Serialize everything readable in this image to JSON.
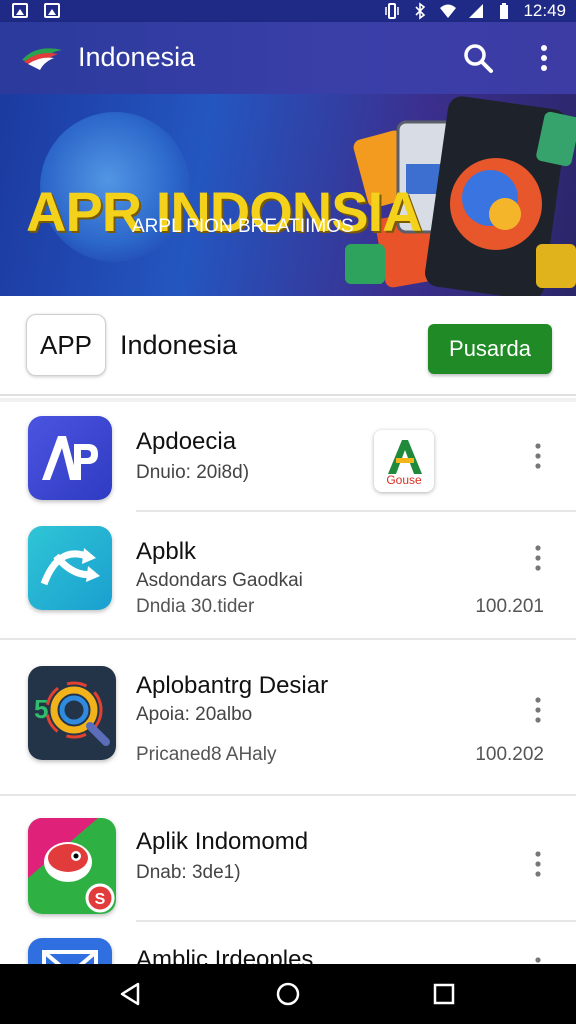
{
  "status_bar": {
    "time": "12:49"
  },
  "app_bar": {
    "title": "Indonesia"
  },
  "banner": {
    "title": "APR INDONSIA",
    "subtitle": "ARPL PION BREATIIMOS",
    "active_slide": 1,
    "slide_count": 2
  },
  "header_card": {
    "badge_label": "APP",
    "name": "Indonesia",
    "button_label": "Pusarda",
    "button_color": "#1f8a26"
  },
  "list": {
    "items": [
      {
        "title": "Apdoecia",
        "subtitle": "Dnuio: 20i8d)",
        "icon": "ap-logo-icon",
        "badge_label": "Gouse"
      },
      {
        "title": "Apblk",
        "subtitle": "Asdondars Gaodkai",
        "meta": "Dndia 30.tider",
        "right": "100.201",
        "icon": "shuffle-icon"
      },
      {
        "title": "Aplobantrg Desiar",
        "subtitle": "Apoia: 20albo",
        "meta": "Pricaned8 AHaly",
        "right": "100.202",
        "icon": "search-lens-icon"
      },
      {
        "title": "Aplik Indomomd",
        "subtitle": "Dnab: 3de1)",
        "icon": "bird-icon"
      },
      {
        "title": "Amblic Irdeoples",
        "icon": "mail-icon"
      }
    ]
  }
}
